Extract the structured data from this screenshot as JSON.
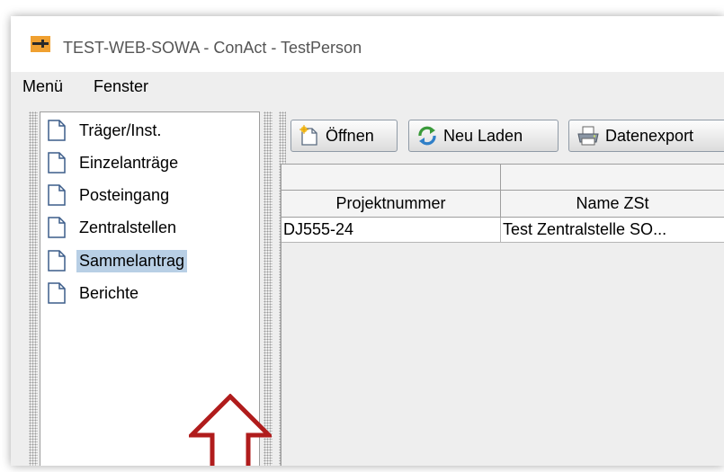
{
  "window": {
    "title": "TEST-WEB-SOWA - ConAct - TestPerson",
    "icon": "conact-app-icon"
  },
  "menubar": {
    "items": [
      {
        "label": "Menü"
      },
      {
        "label": "Fenster"
      }
    ]
  },
  "tree": {
    "selected_index": 4,
    "selection_color": "#b8cfe5",
    "items": [
      {
        "label": "Träger/Inst.",
        "icon": "document-icon"
      },
      {
        "label": "Einzelanträge",
        "icon": "document-icon"
      },
      {
        "label": "Posteingang",
        "icon": "document-icon"
      },
      {
        "label": "Zentralstellen",
        "icon": "document-icon"
      },
      {
        "label": "Sammelantrag",
        "icon": "document-icon"
      },
      {
        "label": "Berichte",
        "icon": "document-icon"
      }
    ]
  },
  "annotation": {
    "icon": "up-arrow-icon",
    "color": "#b01c1c"
  },
  "toolbar": {
    "open_label": "Öffnen",
    "reload_label": "Neu Laden",
    "export_label": "Datenexport",
    "open_icon": "new-document-icon",
    "reload_icon": "refresh-icon",
    "export_icon": "printer-icon"
  },
  "table": {
    "group_headers": [
      "",
      ""
    ],
    "columns": [
      "Projektnummer",
      "Name ZSt"
    ],
    "rows": [
      [
        "DJ555-24",
        "Test Zentralstelle SO..."
      ]
    ]
  }
}
